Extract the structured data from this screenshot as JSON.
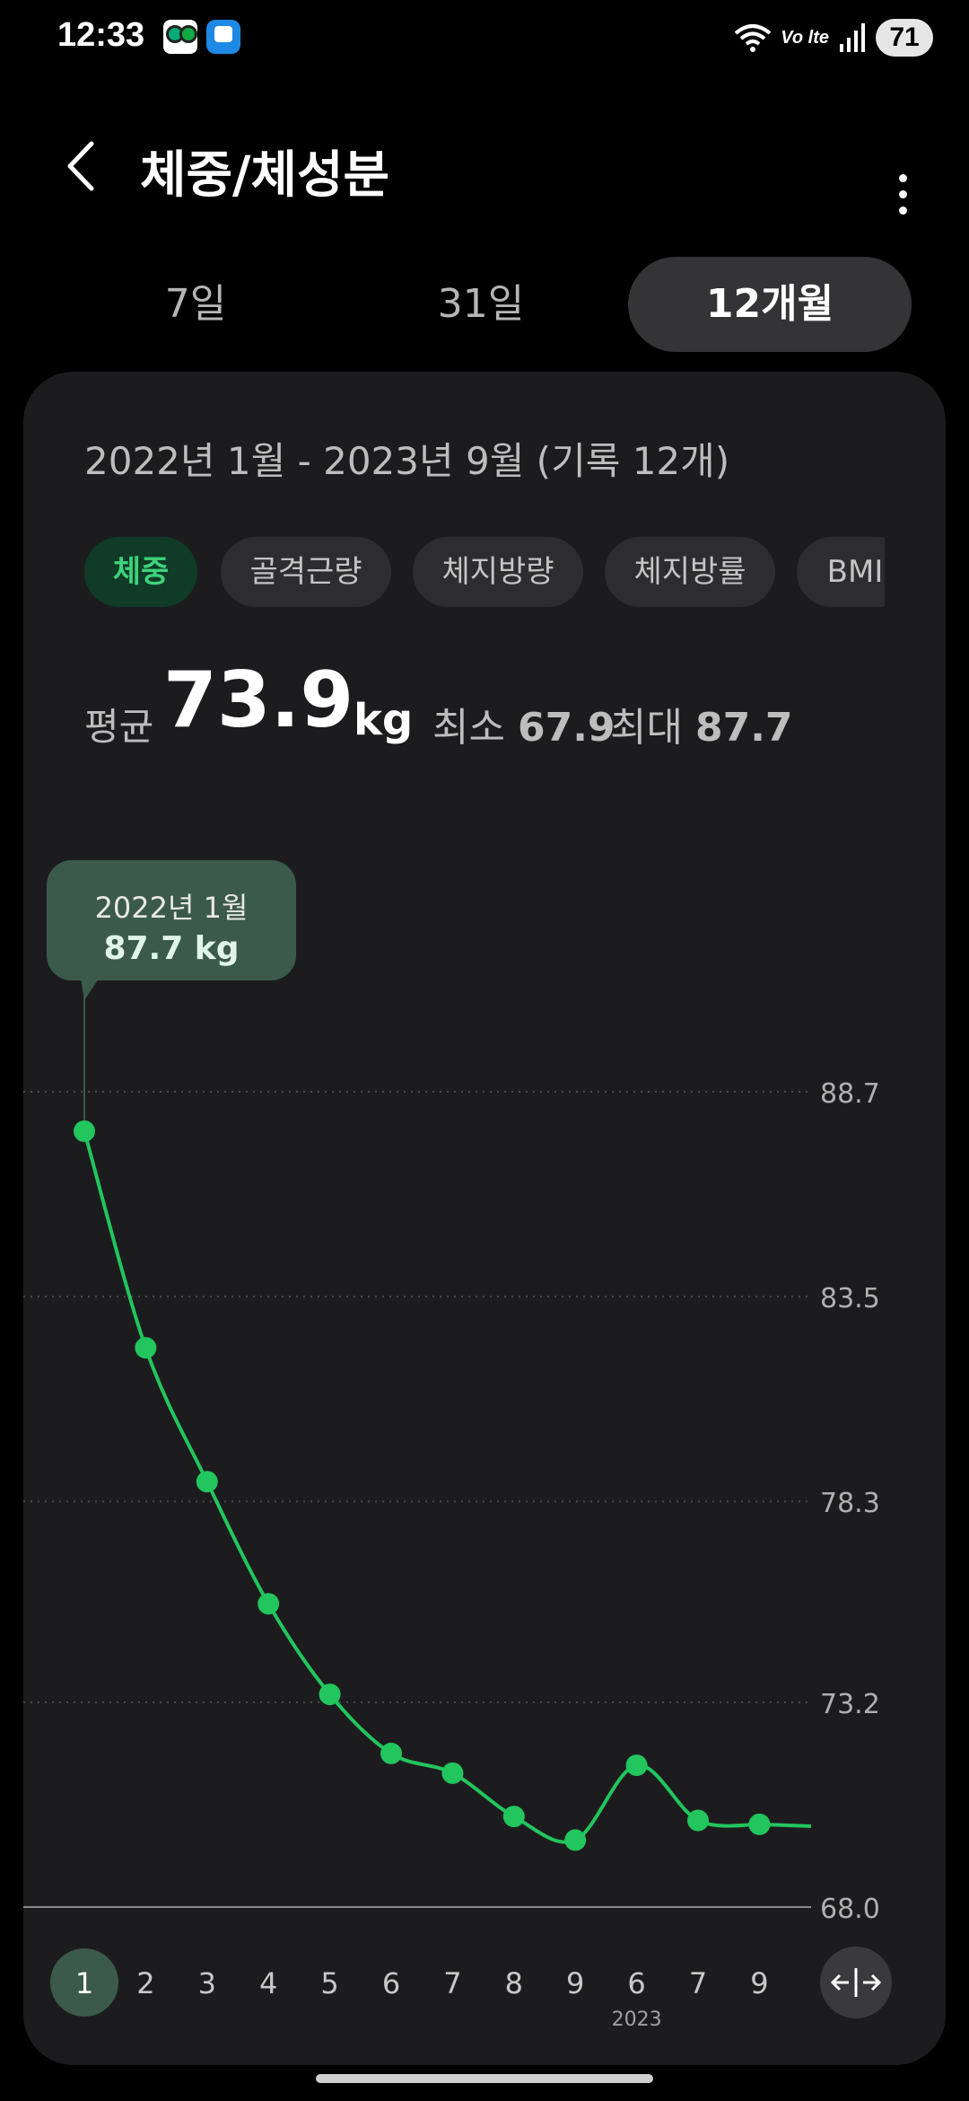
{
  "status_bar": {
    "time": "12:33",
    "network_label": "VoLTE",
    "volte_text": "Vo lte",
    "battery": "71"
  },
  "header": {
    "title": "체중/체성분"
  },
  "period_tabs": [
    {
      "label": "7일",
      "active": false
    },
    {
      "label": "31일",
      "active": false
    },
    {
      "label": "12개월",
      "active": true
    }
  ],
  "card": {
    "range_label": "2022년 1월 - 2023년 9월 (기록 12개)",
    "chips": [
      {
        "label": "체중",
        "active": true
      },
      {
        "label": "골격근량",
        "active": false
      },
      {
        "label": "체지방량",
        "active": false
      },
      {
        "label": "체지방률",
        "active": false
      },
      {
        "label": "BMI",
        "active": false
      }
    ],
    "stats": {
      "avg_label": "평균",
      "avg_value": "73.9",
      "unit": "kg",
      "min_label": "최소",
      "min_value": "67.9",
      "max_label": "최대",
      "max_value": "87.7"
    },
    "tooltip": {
      "date": "2022년 1월",
      "value": "87.7 kg"
    },
    "year_label": "2023"
  },
  "colors": {
    "accent": "#22c55e",
    "tooltip_bg": "#3c5a4c",
    "card_bg": "#1c1c1e"
  },
  "chart_data": {
    "type": "line",
    "categories": [
      "1",
      "2",
      "3",
      "4",
      "5",
      "6",
      "7",
      "8",
      "9",
      "6",
      "7",
      "9"
    ],
    "values": [
      87.7,
      82.2,
      78.8,
      75.7,
      73.4,
      71.9,
      71.4,
      70.3,
      69.7,
      71.6,
      70.2,
      70.1
    ],
    "y_ticks": [
      88.7,
      83.5,
      78.3,
      73.2,
      68.0
    ],
    "ylim": [
      68.0,
      88.7
    ],
    "selected_index": 0,
    "grid": true
  }
}
